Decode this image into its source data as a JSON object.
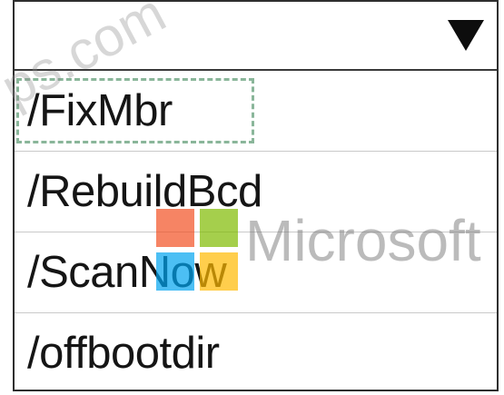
{
  "dropdown": {
    "selected_value": "",
    "arrow_icon": "triangle-down-icon",
    "options": [
      {
        "label": "/FixMbr"
      },
      {
        "label": "/RebuildBcd"
      },
      {
        "label": "/ScanNow"
      },
      {
        "label": "/offbootdir"
      }
    ]
  },
  "watermark": {
    "site_text": "ps.com",
    "brand_text": "Microsoft",
    "logo_colors": [
      "#f25022",
      "#7fba00",
      "#00a4ef",
      "#ffb900"
    ]
  }
}
